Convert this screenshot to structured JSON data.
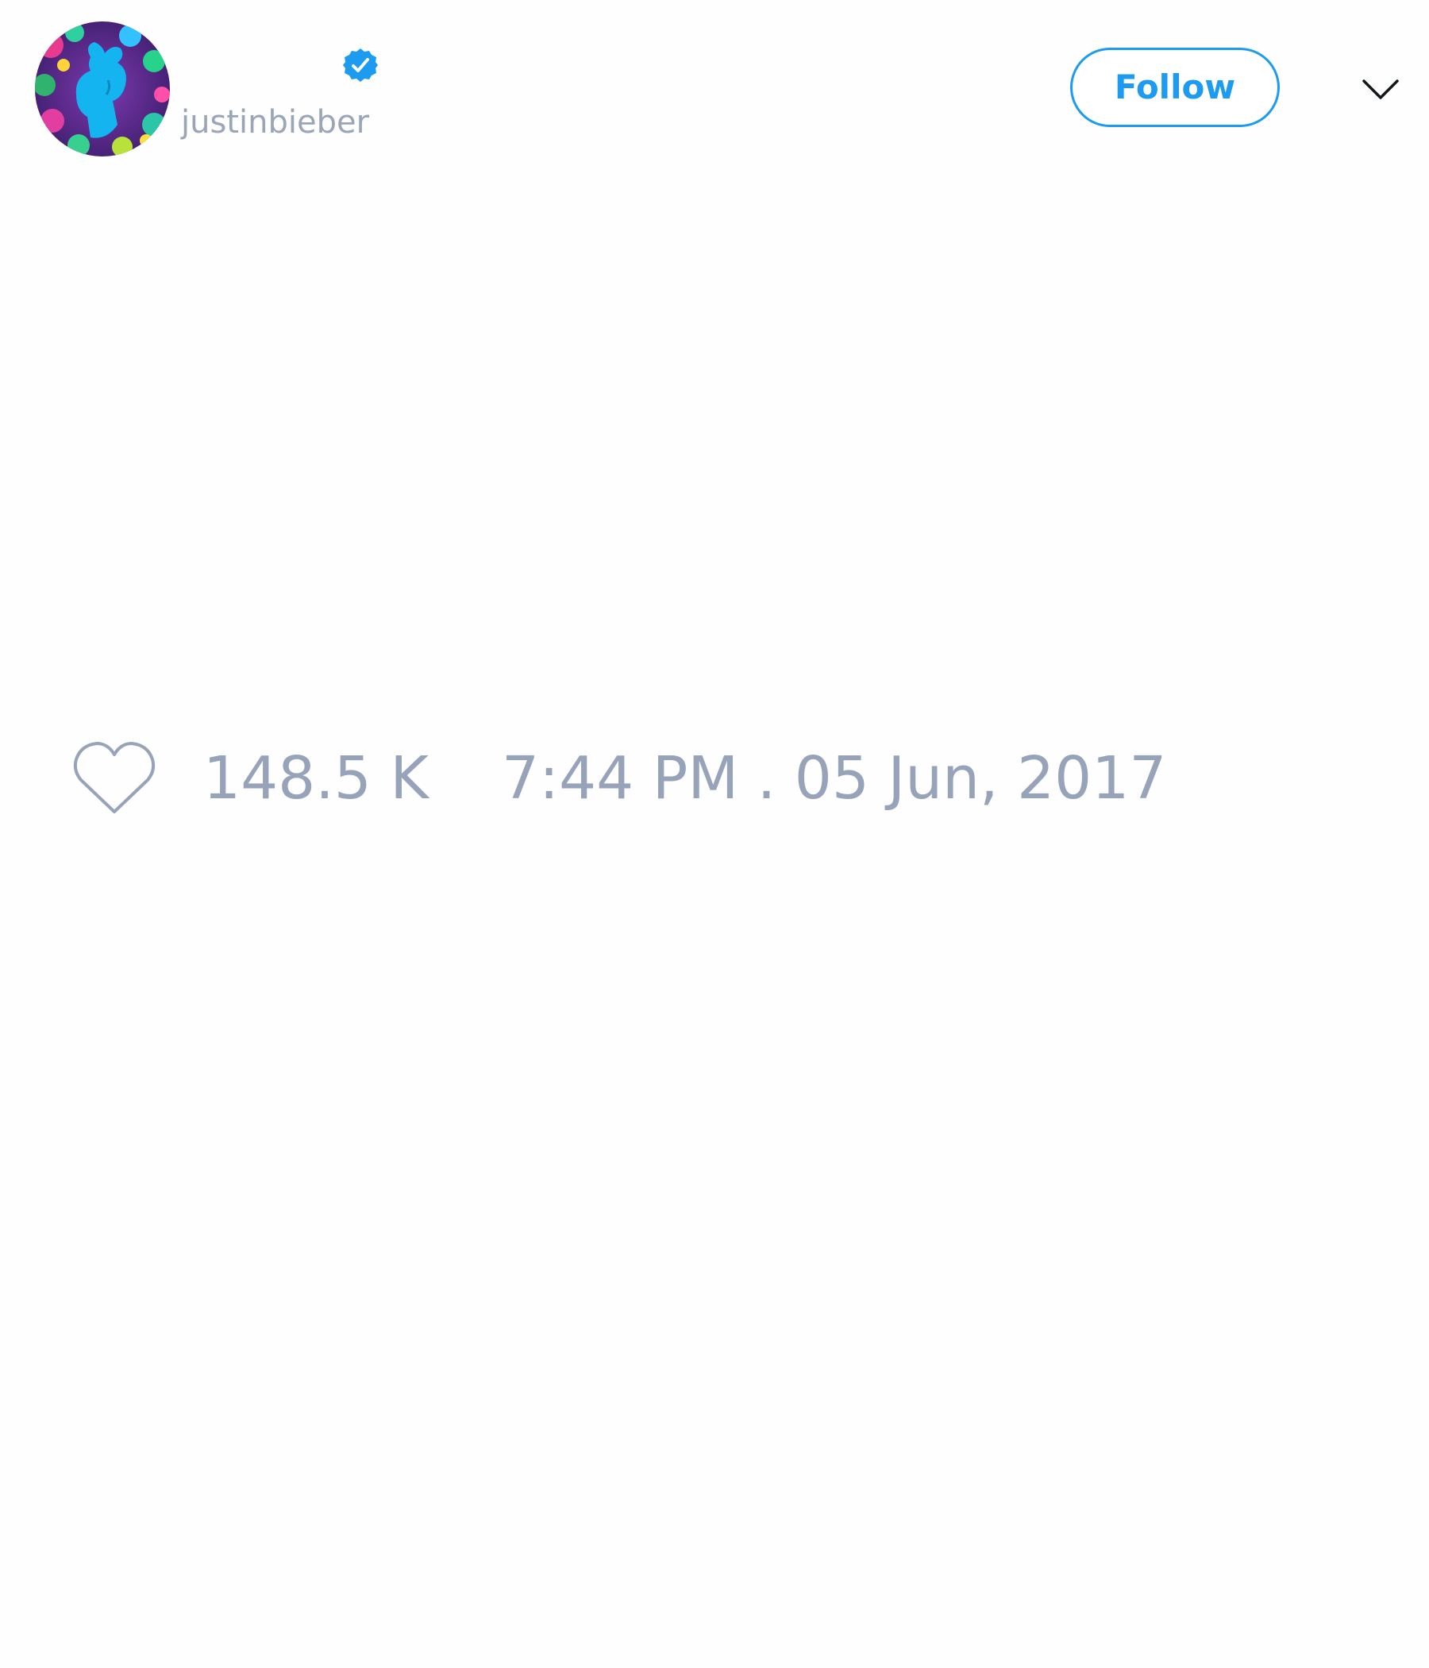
{
  "tweet": {
    "author": {
      "display_name": "",
      "handle": "justinbieber",
      "verified": true,
      "avatar_icon": "profile-avatar"
    },
    "follow_label": "Follow",
    "menu_icon": "chevron-down-icon",
    "text": "",
    "likes": "148.5 K",
    "timestamp": "7:44 PM . 05 Jun, 2017"
  },
  "colors": {
    "accent": "#1d9bf0",
    "muted_text": "#96a3b8",
    "background": "#fefefe"
  }
}
